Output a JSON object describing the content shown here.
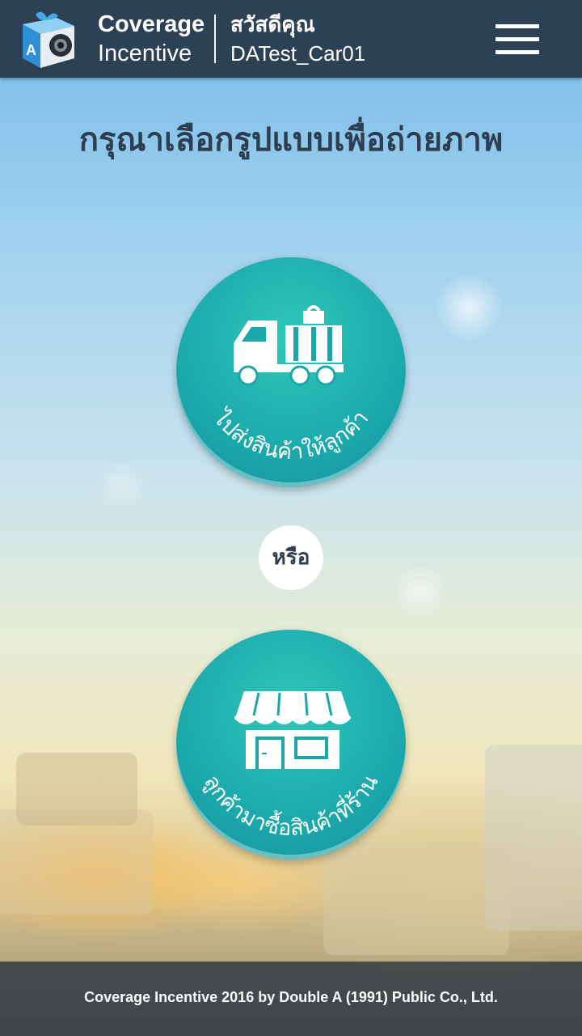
{
  "header": {
    "brand_line1": "Coverage",
    "brand_line2": "Incentive",
    "greeting": "สวัสดีคุณ",
    "username": "DATest_Car01",
    "logo_icon": "camera-gift-icon",
    "menu_icon": "hamburger-menu-icon"
  },
  "main": {
    "title": "กรุณาเลือกรูปแบบเพื่อถ่ายภาพ",
    "option_delivery": {
      "label": "ไปส่งสินค้าให้ลูกค้า",
      "icon": "delivery-truck-icon"
    },
    "or_label": "หรือ",
    "option_store": {
      "label": "ลูกค้ามาซื้อสินค้าที่ร้าน",
      "icon": "storefront-icon"
    }
  },
  "footer": {
    "text": "Coverage Incentive 2016 by Double A (1991) Public Co., Ltd."
  },
  "colors": {
    "header_bg": "#2d4154",
    "accent_teal": "#1aa6aa",
    "title_text": "#2d3e50"
  }
}
